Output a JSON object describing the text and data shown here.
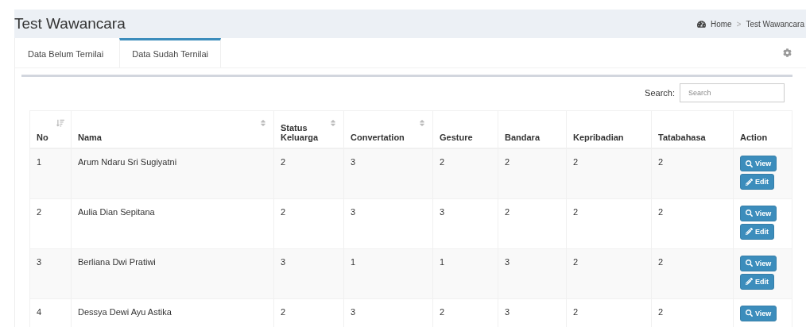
{
  "page_title": "Test Wawancara",
  "breadcrumb": {
    "home": "Home",
    "separator": ">",
    "current": "Test Wawancara"
  },
  "tabs": [
    {
      "label": "Data Belum Ternilai",
      "selected": false
    },
    {
      "label": "Data Sudah Ternilai",
      "selected": true
    }
  ],
  "search": {
    "label": "Search:",
    "placeholder": "Search"
  },
  "table": {
    "columns": [
      {
        "label": "No",
        "kind": "sorted"
      },
      {
        "label": "Nama",
        "kind": "sortable"
      },
      {
        "label": "Status Keluarga",
        "kind": "sortable"
      },
      {
        "label": "Convertation",
        "kind": "sortable"
      },
      {
        "label": "Gesture",
        "kind": "plain"
      },
      {
        "label": "Bandara",
        "kind": "plain"
      },
      {
        "label": "Kepribadian",
        "kind": "plain"
      },
      {
        "label": "Tatabahasa",
        "kind": "plain"
      },
      {
        "label": "Action",
        "kind": "plain"
      }
    ],
    "rows": [
      {
        "cells": [
          "1",
          "Arum Ndaru Sri Sugiyatni",
          "2",
          "3",
          "2",
          "2",
          "2",
          "2"
        ],
        "actions": [
          {
            "kind": "view",
            "label": "View"
          },
          {
            "kind": "edit",
            "label": "Edit"
          }
        ]
      },
      {
        "cells": [
          "2",
          "Aulia Dian Sepitana",
          "2",
          "3",
          "3",
          "2",
          "2",
          "2"
        ],
        "actions": [
          {
            "kind": "view",
            "label": "View"
          },
          {
            "kind": "edit",
            "label": "Edit"
          }
        ]
      },
      {
        "cells": [
          "3",
          "Berliana Dwi Pratiwi",
          "3",
          "1",
          "1",
          "3",
          "2",
          "2"
        ],
        "actions": [
          {
            "kind": "view",
            "label": "View"
          },
          {
            "kind": "edit",
            "label": "Edit"
          }
        ]
      },
      {
        "cells": [
          "4",
          "Dessya Dewi Ayu Astika",
          "2",
          "3",
          "2",
          "3",
          "2",
          "2"
        ],
        "actions": [
          {
            "kind": "view",
            "label": "View"
          }
        ]
      }
    ]
  }
}
